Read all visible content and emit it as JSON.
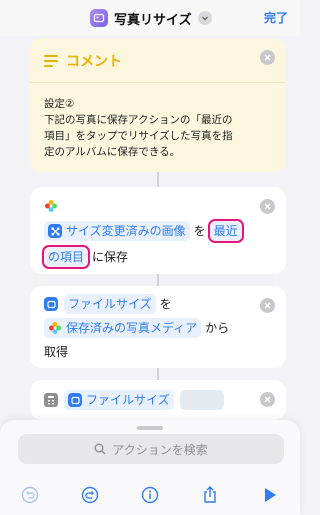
{
  "header": {
    "title": "写真リサイズ",
    "done_label": "完了"
  },
  "comment": {
    "label": "コメント",
    "line1": "設定②",
    "line2": "下記の写真に保存アクションの「最近の",
    "line3": "項目」をタップでリサイズした写真を指",
    "line4": "定のアルバムに保存できる。"
  },
  "save_action": {
    "token_resized": "サイズ変更済みの画像",
    "text_wo": "を",
    "token_album_part1": "最近",
    "token_album_part2": "の項目",
    "text_save": "に保存"
  },
  "file_action": {
    "token_filesize": "ファイルサイズ",
    "text_wo": "を",
    "token_saved_media": "保存済みの写真メディア",
    "text_kara": "から",
    "text_get": "取得"
  },
  "calc_action": {
    "token_filesize": "ファイルサイズ"
  },
  "search": {
    "placeholder": "アクションを検索"
  },
  "colors": {
    "accent": "#2f7cf6",
    "comment_yellow": "#e7b100",
    "highlight": "#e5157a"
  },
  "icons": [
    "app-icon",
    "chevron-down-icon",
    "close-icon",
    "comment-lines-icon",
    "photos-icon",
    "resize-icon",
    "file-icon",
    "calculator-icon",
    "search-icon",
    "undo-icon",
    "redo-icon",
    "info-icon",
    "share-icon",
    "play-icon"
  ]
}
